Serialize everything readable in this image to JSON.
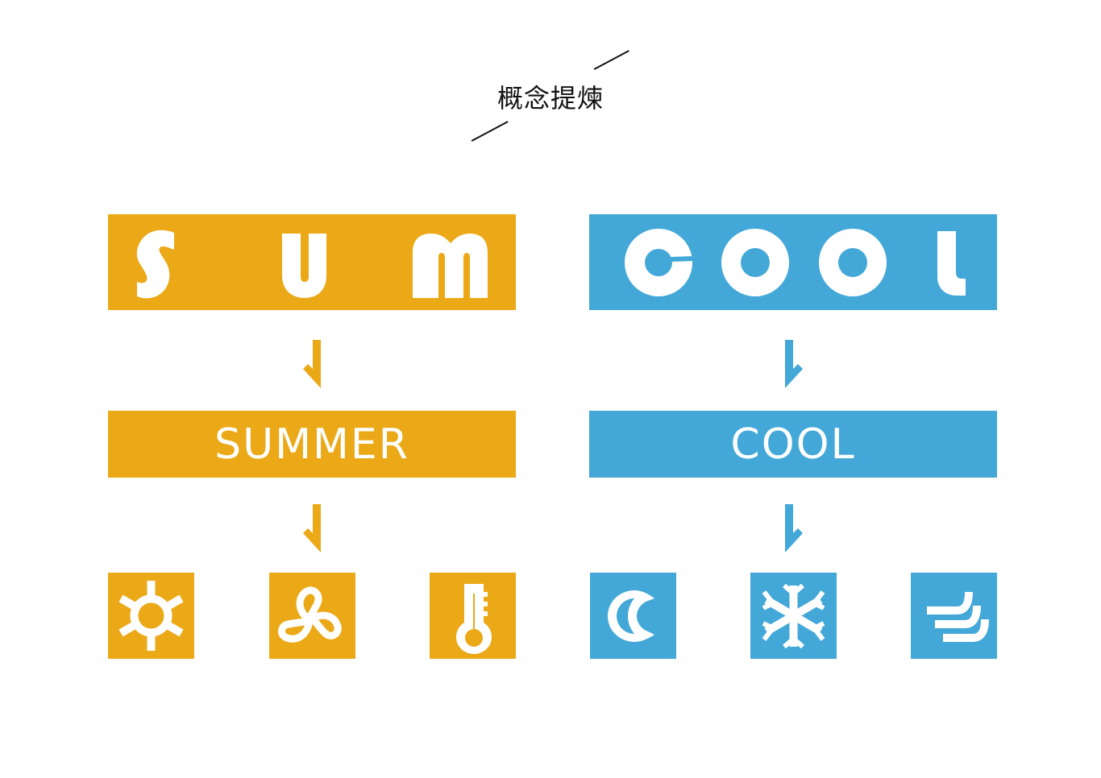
{
  "colors": {
    "summer": "#EBA918",
    "cool": "#43A8D8",
    "foreground": "#FFFFFF",
    "text": "#111111"
  },
  "header": {
    "title": "概念提煉"
  },
  "left_branch": {
    "logo_letters": [
      "S",
      "U",
      "M"
    ],
    "logo_word": "SUM",
    "concept_label": "SUMMER",
    "icons": [
      {
        "name": "sun-icon",
        "label": "sun"
      },
      {
        "name": "fan-icon",
        "label": "fan"
      },
      {
        "name": "thermometer-icon",
        "label": "thermometer"
      }
    ]
  },
  "right_branch": {
    "logo_letters": [
      "C",
      "O",
      "O",
      "L"
    ],
    "logo_word": "COOL",
    "concept_label": "COOL",
    "icons": [
      {
        "name": "moon-icon",
        "label": "moon"
      },
      {
        "name": "snowflake-icon",
        "label": "snowflake"
      },
      {
        "name": "wind-icon",
        "label": "wind"
      }
    ]
  }
}
